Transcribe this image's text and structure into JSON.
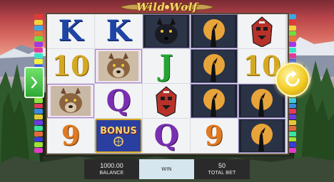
{
  "game": {
    "title": "Wild Wolf"
  },
  "reels": [
    [
      "K",
      "10",
      "wolf",
      "9"
    ],
    [
      "K",
      "wolf",
      "Q",
      "BONUS"
    ],
    [
      "black-wolf",
      "J",
      "totem",
      "Q"
    ],
    [
      "moon-wolf",
      "moon-wolf",
      "moon-wolf",
      "9"
    ],
    [
      "totem",
      "10",
      "moon-wolf",
      "moon-wolf"
    ]
  ],
  "bonus_symbol": {
    "label": "BONUS"
  },
  "balance": {
    "value": "1000.00",
    "label": "BALANCE"
  },
  "win": {
    "value": "",
    "label": "WIN"
  },
  "total_bet": {
    "value": "50",
    "label": "TOTAL BET"
  },
  "colors": {
    "k": "#1e44a6",
    "j": "#27a435",
    "q": "#7a2fb2",
    "ten": "#d4a822",
    "nine": "#e07a20",
    "spin_button": "#f2cc24",
    "nav_button": "#2ea835"
  },
  "icons": {
    "next": "chevron-right-icon",
    "spin": "refresh-arrow-icon"
  }
}
